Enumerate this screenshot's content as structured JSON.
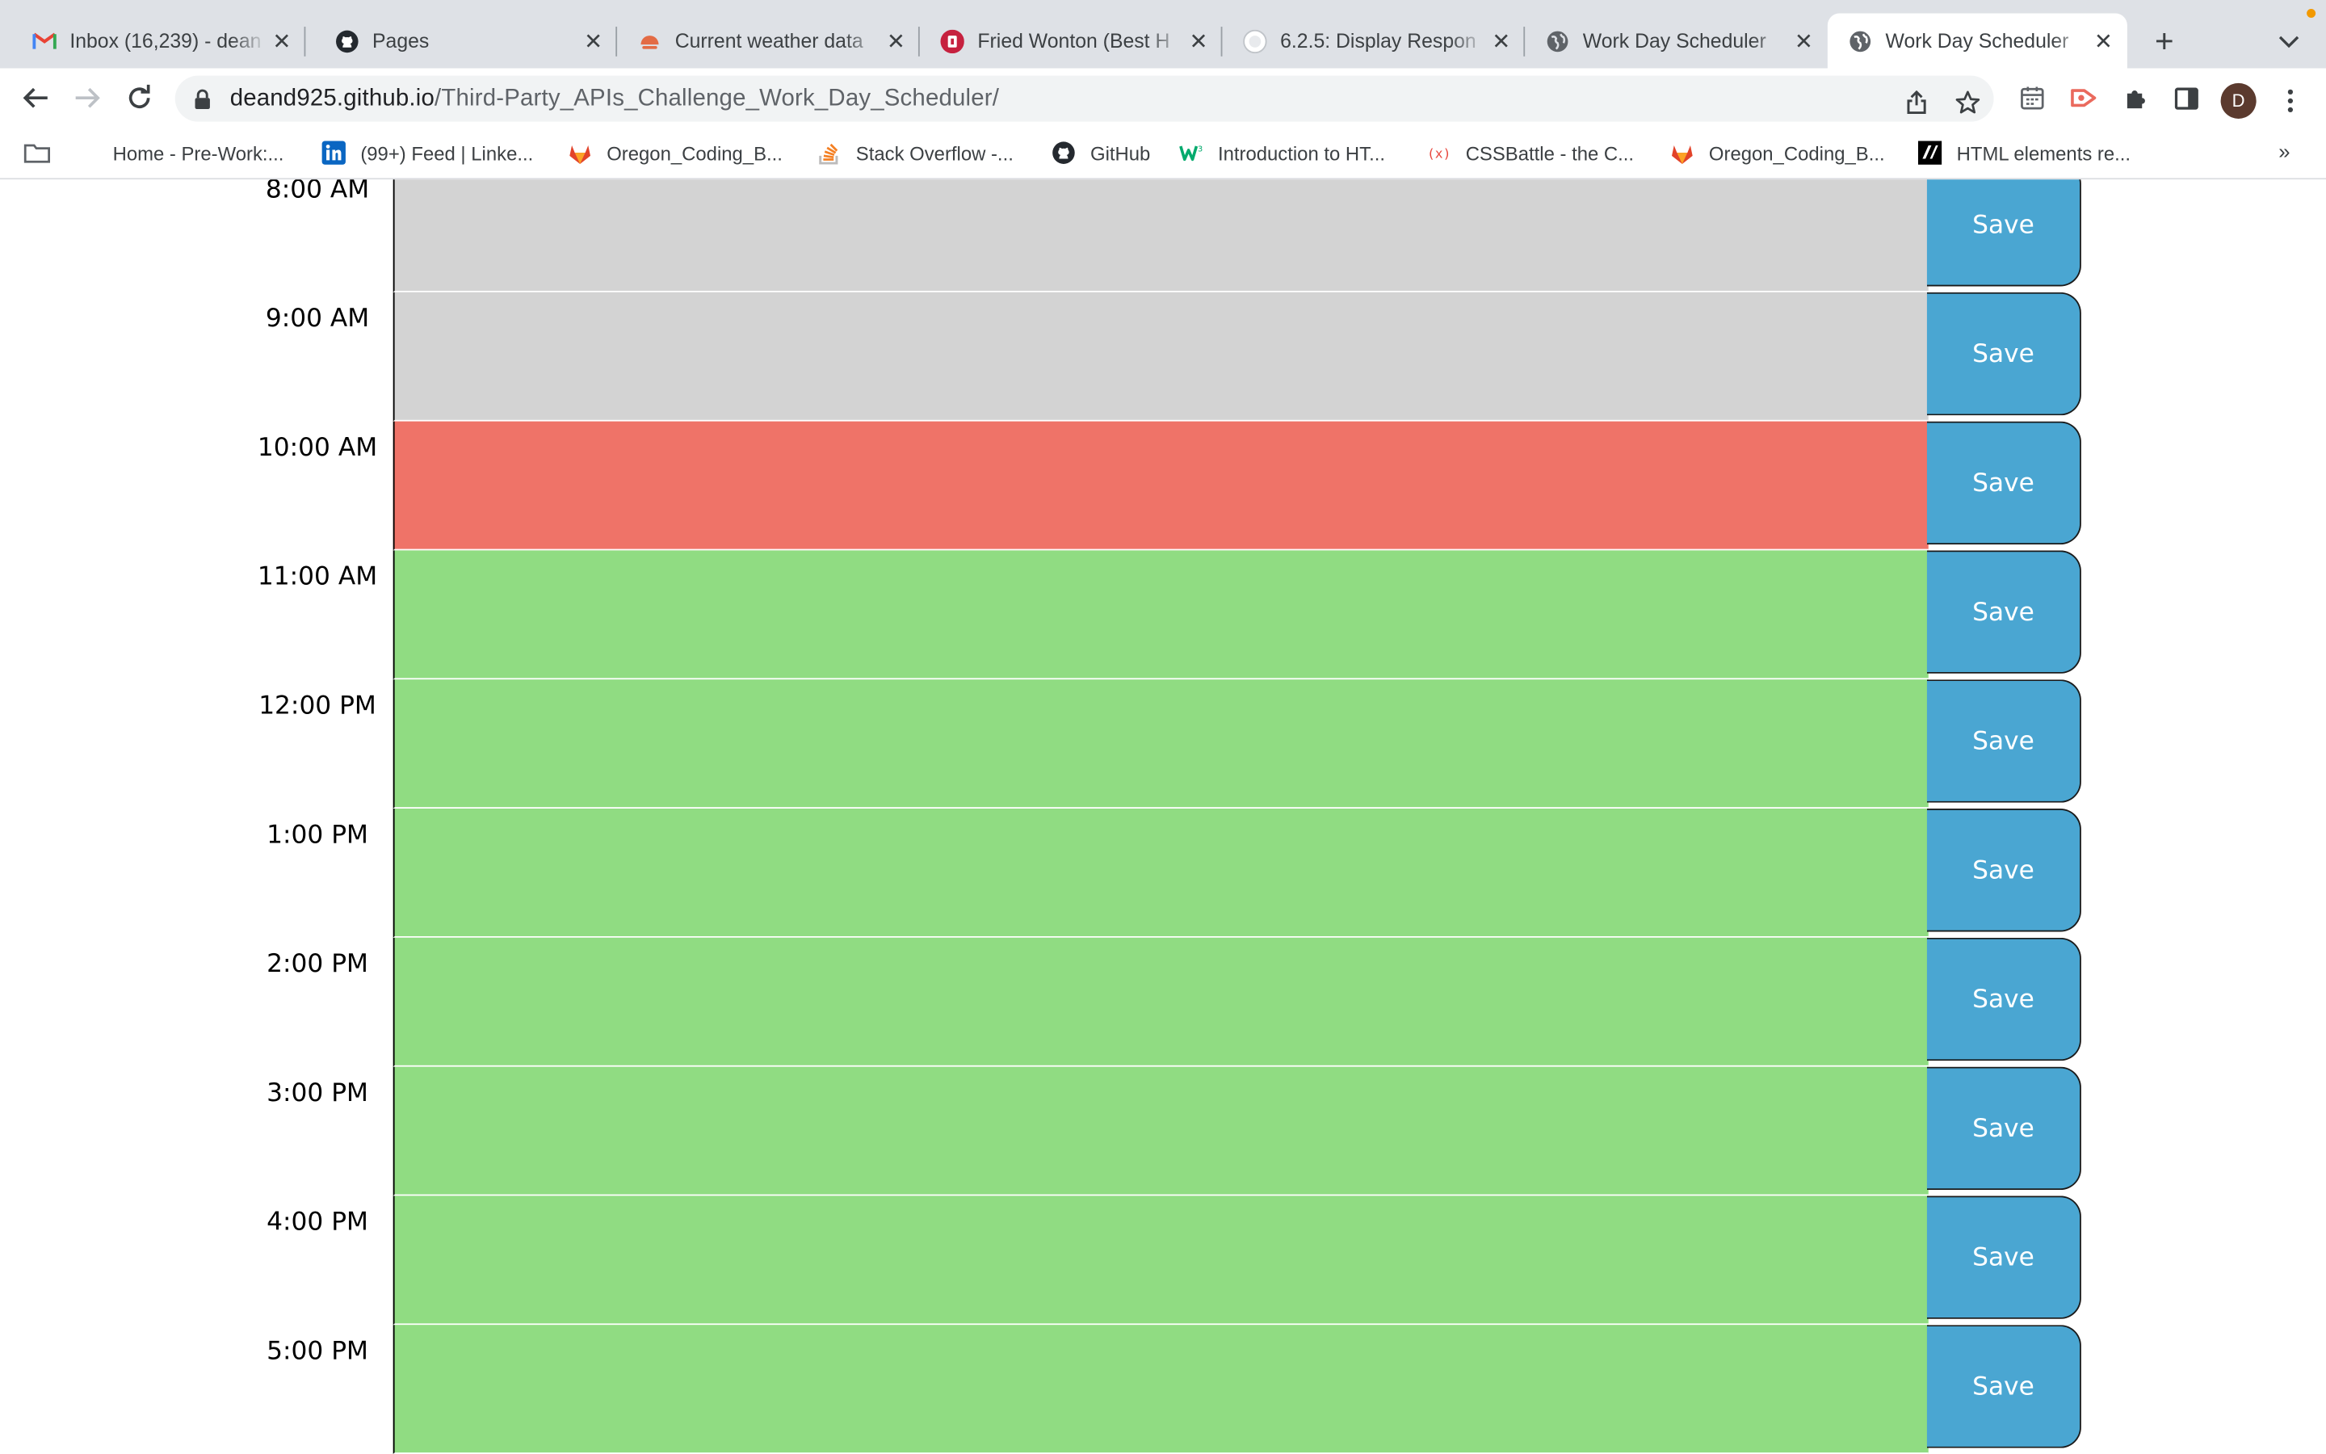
{
  "browser": {
    "tabs": [
      {
        "title": "Inbox (16,239) - dean",
        "favicon": "gmail-icon",
        "active": false
      },
      {
        "title": "Pages",
        "favicon": "github-icon",
        "active": false
      },
      {
        "title": "Current weather data",
        "favicon": "weather-icon",
        "active": false
      },
      {
        "title": "Fried Wonton (Best H",
        "favicon": "recipe-icon",
        "active": false
      },
      {
        "title": "6.2.5: Display Respon",
        "favicon": "course-icon",
        "active": false
      },
      {
        "title": "Work Day Scheduler",
        "favicon": "globe-icon",
        "active": false
      },
      {
        "title": "Work Day Scheduler",
        "favicon": "globe-icon",
        "active": true
      }
    ],
    "url_host": "deand925.github.io",
    "url_path": "/Third-Party_APIs_Challenge_Work_Day_Scheduler/",
    "profile_initial": "D",
    "bookmarks": [
      {
        "label": "Home - Pre-Work:...",
        "icon": "folder-page-icon"
      },
      {
        "label": "(99+) Feed | Linke...",
        "icon": "linkedin-icon"
      },
      {
        "label": "Oregon_Coding_B...",
        "icon": "gitlab-icon"
      },
      {
        "label": "Stack Overflow -...",
        "icon": "stackoverflow-icon"
      },
      {
        "label": "GitHub",
        "icon": "github-icon"
      },
      {
        "label": "Introduction to HT...",
        "icon": "w3schools-icon"
      },
      {
        "label": "CSSBattle - the C...",
        "icon": "cssbattle-icon"
      },
      {
        "label": "Oregon_Coding_B...",
        "icon": "gitlab-icon"
      },
      {
        "label": "HTML elements re...",
        "icon": "mdn-icon"
      }
    ],
    "bookmarks_more": "»"
  },
  "colors": {
    "past": "#d3d3d3",
    "present": "#ef7368",
    "future": "#90dc82",
    "save": "#4aa6d2"
  },
  "scheduler": {
    "save_label": "Save",
    "blocks": [
      {
        "hour": "8:00 AM",
        "state": "past",
        "text": ""
      },
      {
        "hour": "9:00 AM",
        "state": "past",
        "text": ""
      },
      {
        "hour": "10:00 AM",
        "state": "present",
        "text": ""
      },
      {
        "hour": "11:00 AM",
        "state": "future",
        "text": ""
      },
      {
        "hour": "12:00 PM",
        "state": "future",
        "text": ""
      },
      {
        "hour": "1:00 PM",
        "state": "future",
        "text": ""
      },
      {
        "hour": "2:00 PM",
        "state": "future",
        "text": ""
      },
      {
        "hour": "3:00 PM",
        "state": "future",
        "text": ""
      },
      {
        "hour": "4:00 PM",
        "state": "future",
        "text": ""
      },
      {
        "hour": "5:00 PM",
        "state": "future",
        "text": ""
      }
    ]
  }
}
